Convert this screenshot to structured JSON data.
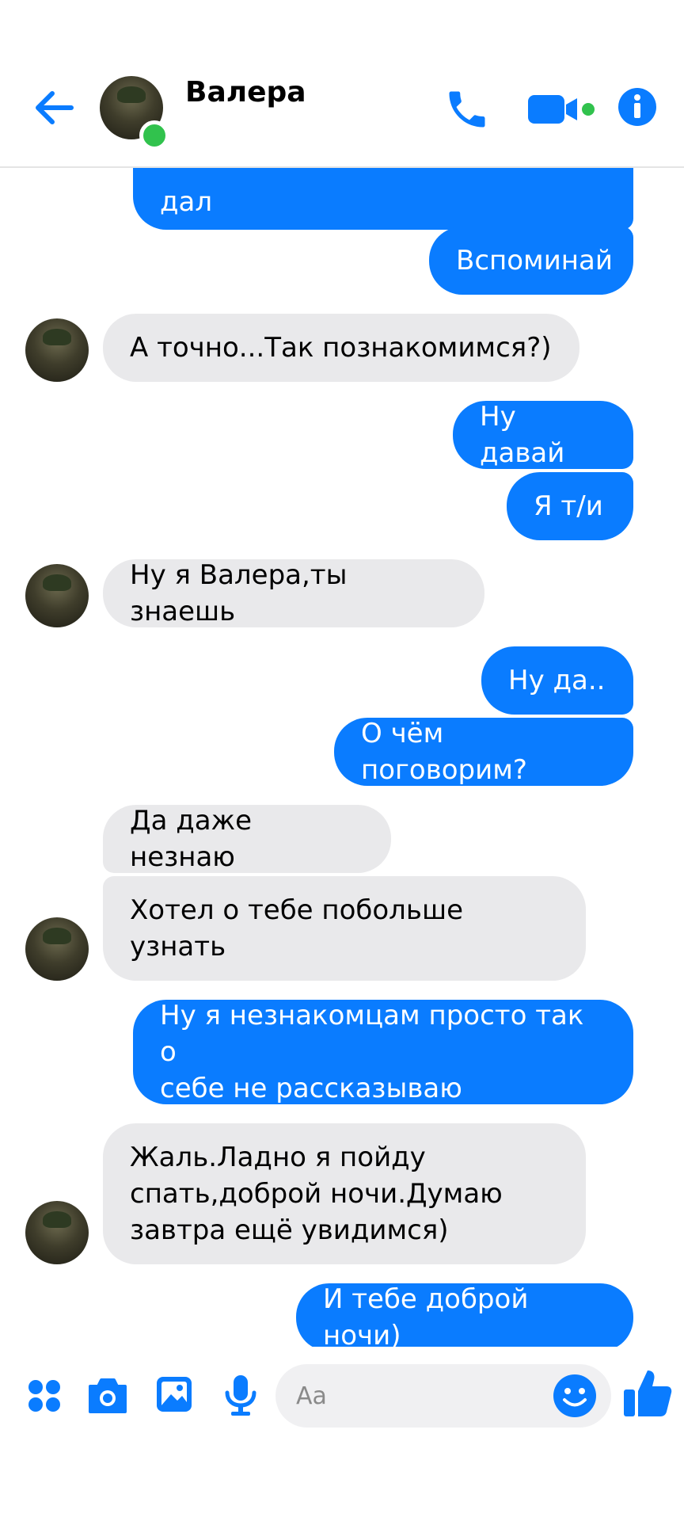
{
  "header": {
    "contact_name": "Валера",
    "online": true
  },
  "messages": [
    {
      "side": "out",
      "text": "дал"
    },
    {
      "side": "out",
      "text": "Вспоминай"
    },
    {
      "side": "in",
      "text": "А точно...Так познакомимся?)"
    },
    {
      "side": "out",
      "text": "Ну давай"
    },
    {
      "side": "out",
      "text": "Я т/и"
    },
    {
      "side": "in",
      "text": "Ну я Валера,ты знаешь"
    },
    {
      "side": "out",
      "text": "Ну да.."
    },
    {
      "side": "out",
      "text": "О чём поговорим?"
    },
    {
      "side": "in",
      "text": "Да даже незнаю"
    },
    {
      "side": "in",
      "text": "Хотел о тебе побольше\nузнать"
    },
    {
      "side": "out",
      "text": "Ну я незнакомцам просто так о\nсебе не рассказываю"
    },
    {
      "side": "in",
      "text": "Жаль.Ладно я пойду\nспать,доброй ночи.Думаю\nзавтра ещё увидимся)"
    },
    {
      "side": "out",
      "text": "И тебе доброй ночи)"
    }
  ],
  "composer": {
    "placeholder": "Aa"
  },
  "icons": {
    "header": [
      "back-arrow-icon",
      "phone-icon",
      "video-camera-icon",
      "info-icon"
    ],
    "composer": [
      "menu-dots-icon",
      "camera-icon",
      "gallery-icon",
      "microphone-icon",
      "emoji-icon",
      "thumbs-up-icon"
    ]
  },
  "colors": {
    "accent": "#0a7cff",
    "incoming_bubble": "#e9e9eb",
    "online": "#31c24d"
  }
}
